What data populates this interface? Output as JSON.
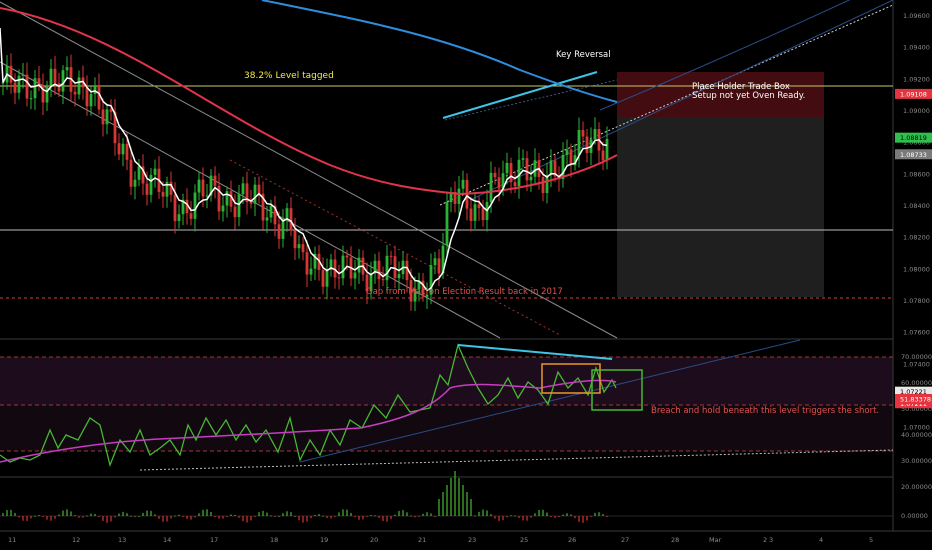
{
  "chart_data": [
    {
      "type": "candlestick",
      "ylim": [
        1.068,
        1.098
      ],
      "y_ticks": [
        "1.09600",
        "1.09400",
        "1.09200",
        "1.09000",
        "1.08800",
        "1.08600",
        "1.08400",
        "1.08200",
        "1.08000",
        "1.07800",
        "1.07600",
        "1.07400",
        "1.07200",
        "1.07000"
      ],
      "x_ticks": [
        "11",
        "12",
        "13",
        "14",
        "17",
        "18",
        "19",
        "20",
        "21",
        "23",
        "25",
        "26",
        "27",
        "28",
        "2",
        "3",
        "4",
        "5"
      ],
      "x_tick_extra": "Mar",
      "price_badges": [
        {
          "label": "1.09108",
          "value": 1.09108,
          "color": "#e5343f",
          "text": "light"
        },
        {
          "label": "1.08819",
          "value": 1.08819,
          "color": "#2fbf4f",
          "text": "dark"
        },
        {
          "label": "1.08733",
          "value": 1.08733,
          "color": "#7a7a7a",
          "text": "light"
        },
        {
          "label": "1.07221",
          "value": 1.07221,
          "color": "#e8e8e8",
          "text": "dark"
        },
        {
          "label": "1.07211",
          "value": 1.07211,
          "color": "#e5343f",
          "text": "light"
        }
      ],
      "annotations": {
        "fib_level": "38.2% Level tagged",
        "key_reversal": "Key Reversal",
        "trade_box_line1": "Place Holder Trade Box",
        "trade_box_line2": "Setup not yet Oven Ready.",
        "gap_label": "Gap from Macron Election Result back in 2017"
      },
      "levels": {
        "fib": 1.09,
        "support": 1.078,
        "gap": 1.0722
      },
      "trade_box": {
        "entry": 1.0875,
        "stop": 1.091,
        "target": 1.0722
      },
      "colors": {
        "up": "#2bb336",
        "down": "#d63636",
        "ma_fast": "#ffffff",
        "ma_red": "#e0344a",
        "ma_blue": "#2e8ede",
        "trend_cyan": "#3fc4e6"
      }
    },
    {
      "type": "line",
      "ylim": [
        20,
        80
      ],
      "y_ticks": [
        "70.00000",
        "60.00000",
        "50.00000",
        "40.00000",
        "30.00000",
        "20.00000"
      ],
      "badge": {
        "label": "51.83378",
        "value": 51.83,
        "color": "#e5343f"
      },
      "note": "Breach and hold beneath this level triggers the short.",
      "levels": {
        "upper": 70,
        "lower": 52,
        "base": 30
      },
      "colors": {
        "rsi": "#46b832",
        "signal": "#c43ec0",
        "divergence": "#3fc4e6"
      }
    },
    {
      "type": "bar",
      "y_ticks": [
        "0.00000"
      ],
      "colors": {
        "up": "#46b832",
        "down": "#d63636"
      }
    }
  ]
}
